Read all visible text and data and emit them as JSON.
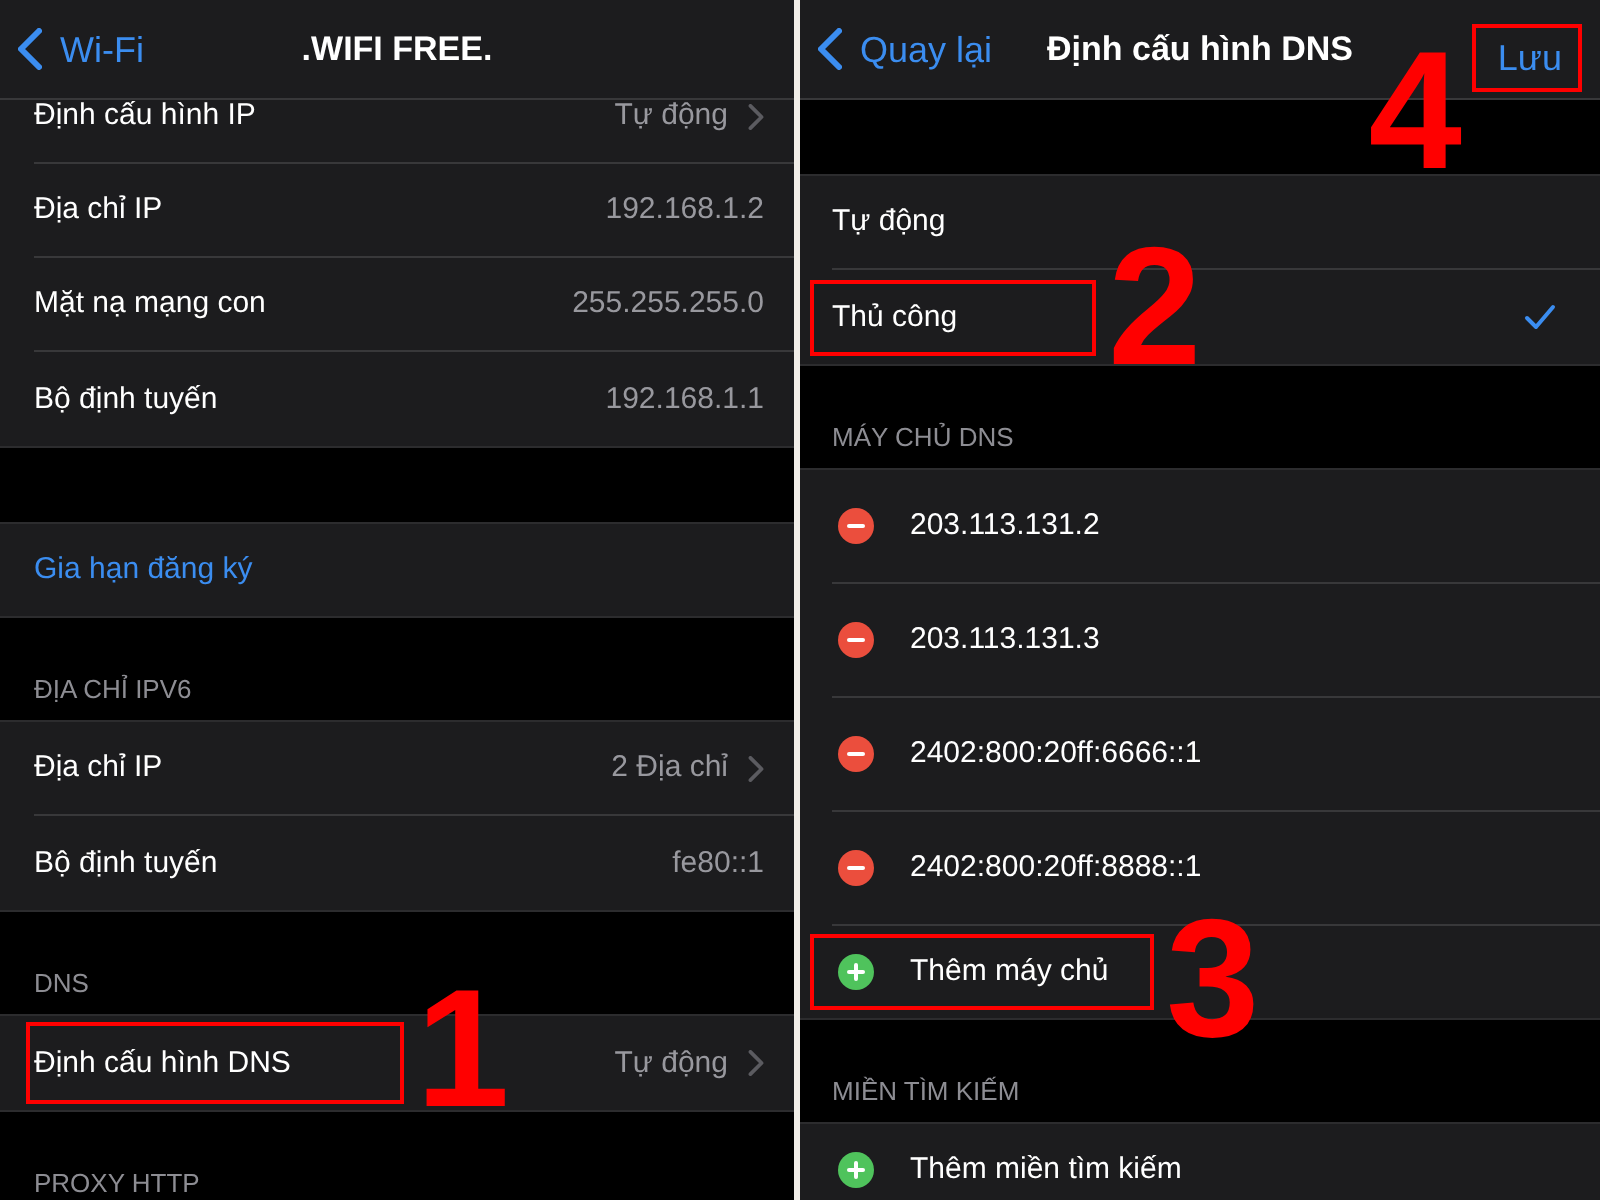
{
  "screens": [
    {
      "nav": {
        "back": "Wi-Fi",
        "title": ".WIFI FREE."
      },
      "sections": [
        {
          "rows": [
            {
              "kind": "disclosure",
              "label": "Định cấu hình IP",
              "value": "Tự động",
              "highlighted": false
            },
            {
              "kind": "value",
              "label": "Địa chỉ IP",
              "value": "192.168.1.2",
              "highlighted": false
            },
            {
              "kind": "value",
              "label": "Mặt nạ mạng con",
              "value": "255.255.255.0",
              "highlighted": false
            },
            {
              "kind": "value",
              "label": "Bộ định tuyến",
              "value": "192.168.1.1",
              "highlighted": false
            }
          ]
        },
        {
          "rows": [
            {
              "kind": "link",
              "label": "Gia hạn đăng ký",
              "highlighted": false
            }
          ]
        },
        {
          "header": "ĐỊA CHỈ IPV6",
          "rows": [
            {
              "kind": "disclosure",
              "label": "Địa chỉ IP",
              "value": "2 Địa chỉ",
              "highlighted": false
            },
            {
              "kind": "value",
              "label": "Bộ định tuyến",
              "value": "fe80::1",
              "highlighted": false
            }
          ]
        },
        {
          "header": "DNS",
          "rows": [
            {
              "kind": "disclosure",
              "label": "Định cấu hình DNS",
              "value": "Tự động",
              "highlighted": true,
              "step": "1"
            }
          ]
        },
        {
          "header": "PROXY HTTP"
        }
      ]
    },
    {
      "nav": {
        "back": "Quay lại",
        "title": "Định cấu hình DNS",
        "action": {
          "label": "Lưu",
          "highlighted": true,
          "step": "4"
        }
      },
      "sections": [
        {
          "rows": [
            {
              "kind": "option",
              "label": "Tự động",
              "selected": false,
              "highlighted": false
            },
            {
              "kind": "option",
              "label": "Thủ công",
              "selected": true,
              "highlighted": true,
              "step": "2"
            }
          ]
        },
        {
          "header": "MÁY CHỦ DNS",
          "rows": [
            {
              "kind": "remove",
              "label": "203.113.131.2",
              "highlighted": false
            },
            {
              "kind": "remove",
              "label": "203.113.131.3",
              "highlighted": false
            },
            {
              "kind": "remove",
              "label": "2402:800:20ff:6666::1",
              "highlighted": false
            },
            {
              "kind": "remove",
              "label": "2402:800:20ff:8888::1",
              "highlighted": false
            },
            {
              "kind": "add",
              "label": "Thêm máy chủ",
              "highlighted": true,
              "step": "3"
            }
          ]
        },
        {
          "header": "MIỀN TÌM KIẾM",
          "rows": [
            {
              "kind": "add",
              "label": "Thêm miền tìm kiếm",
              "highlighted": false
            }
          ]
        }
      ]
    }
  ]
}
